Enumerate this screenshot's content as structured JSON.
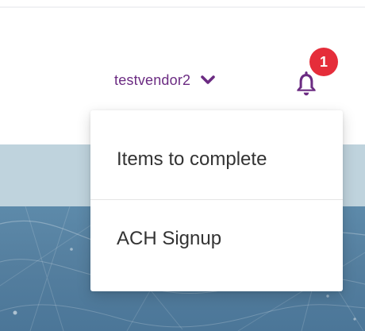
{
  "header": {
    "username": "testvendor2",
    "notifications": {
      "count": "1"
    }
  },
  "dropdown": {
    "items": [
      {
        "label": "Items to complete"
      },
      {
        "label": "ACH Signup"
      }
    ]
  },
  "icons": {
    "user_menu": "chevron-down-icon",
    "notifications": "bell-icon"
  },
  "colors": {
    "username": "#6b2b82",
    "bell": "#6b2b82",
    "badge": "#e52d3a",
    "menu_text": "#333333",
    "strip": "#bfd3dd",
    "hero": "#557f9f"
  }
}
